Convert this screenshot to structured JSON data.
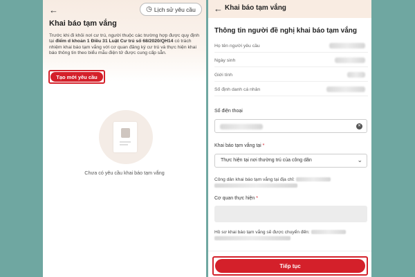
{
  "left": {
    "history_label": "Lịch sử yêu cầu",
    "title": "Khai báo tạm vắng",
    "desc_part1": "Trước khi đi khỏi nơi cư trú, người thuộc các trường hợp được quy định tại ",
    "desc_bold": "điểm d khoản 1 Điều 31 Luật Cư trú số 68/2020/QH14",
    "desc_part2": " có trách nhiệm khai báo tạm vắng với cơ quan đăng ký cư trú và thực hiện khai báo thông tin theo biểu mẫu điện tử được cung cấp sẵn.",
    "create_label": "Tạo mới yêu cầu",
    "empty_text": "Chưa có yêu cầu khai báo tạm vắng"
  },
  "right": {
    "header_title": "Khai báo tạm vắng",
    "form_title": "Thông tin người đề nghị khai báo tạm vắng",
    "info_rows": [
      {
        "label": "Họ tên người yêu cầu"
      },
      {
        "label": "Ngày sinh"
      },
      {
        "label": "Giới tính"
      },
      {
        "label": "Số định danh cá nhân"
      }
    ],
    "phone_label": "Số điện thoại",
    "location_label": "Khai báo tạm vắng tại",
    "location_required": "*",
    "location_value": "Thực hiện tại nơi thường trú của công dân",
    "address_note": "Công dân khai báo tạm vắng tại địa chỉ:",
    "agency_label": "Cơ quan thực hiện",
    "agency_required": "*",
    "transfer_note": "Hồ sơ khai báo tạm vắng sẽ được chuyển đến:",
    "continue_label": "Tiếp tục"
  },
  "icons": {
    "back": "arrow-left-icon",
    "history": "clock-icon",
    "clear": "clear-icon",
    "chevron": "chevron-down-icon"
  },
  "colors": {
    "accent": "#d4202a",
    "background": "#6fa7a1",
    "header_tint": "#f9ece2"
  }
}
